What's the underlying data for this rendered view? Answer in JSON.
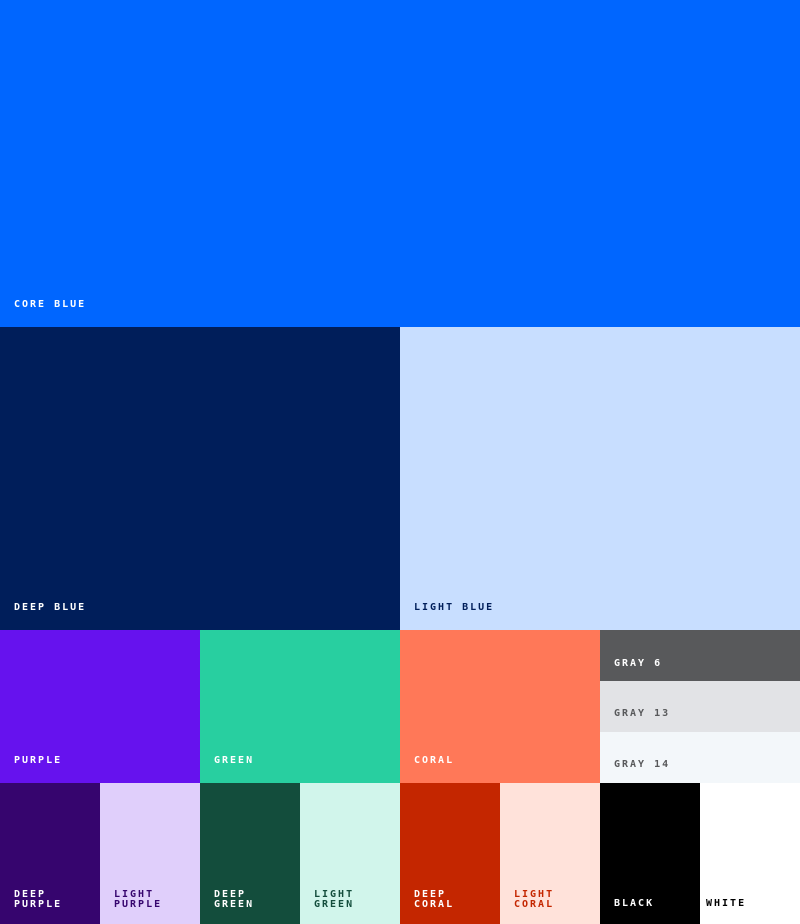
{
  "swatches": {
    "core_blue": {
      "label": "CORE BLUE",
      "color": "#0066FF",
      "text_color": "#FFFFFF"
    },
    "deep_blue": {
      "label": "DEEP BLUE",
      "color": "#001E5A",
      "text_color": "#FFFFFF"
    },
    "light_blue": {
      "label": "LIGHT BLUE",
      "color": "#C8DEFF",
      "text_color": "#001E5A"
    },
    "purple": {
      "label": "PURPLE",
      "color": "#6612EE",
      "text_color": "#FFFFFF"
    },
    "green": {
      "label": "GREEN",
      "color": "#28CFA0",
      "text_color": "#FFFFFF"
    },
    "coral": {
      "label": "CORAL",
      "color": "#FF7858",
      "text_color": "#FFFFFF"
    },
    "gray_6": {
      "label": "GRAY 6",
      "color": "#58595B",
      "text_color": "#FFFFFF"
    },
    "gray_13": {
      "label": "GRAY 13",
      "color": "#E2E3E6",
      "text_color": "#58595B"
    },
    "gray_14": {
      "label": "GRAY 14",
      "color": "#F3F7FA",
      "text_color": "#58595B"
    },
    "deep_purple": {
      "label": "DEEP\nPURPLE",
      "color": "#36056E",
      "text_color": "#FFFFFF"
    },
    "light_purple": {
      "label": "LIGHT\nPURPLE",
      "color": "#E0CFFB",
      "text_color": "#36056E"
    },
    "deep_green": {
      "label": "DEEP\nGREEN",
      "color": "#134D3C",
      "text_color": "#FFFFFF"
    },
    "light_green": {
      "label": "LIGHT\nGREEN",
      "color": "#D1F5EB",
      "text_color": "#134D3C"
    },
    "deep_coral": {
      "label": "DEEP\nCORAL",
      "color": "#C42600",
      "text_color": "#FFFFFF"
    },
    "light_coral": {
      "label": "LIGHT\nCORAL",
      "color": "#FFE2DA",
      "text_color": "#C42600"
    },
    "black": {
      "label": "BLACK",
      "color": "#000000",
      "text_color": "#FFFFFF"
    },
    "white": {
      "label": "WHITE",
      "color": "#FFFFFF",
      "text_color": "#000000"
    }
  }
}
